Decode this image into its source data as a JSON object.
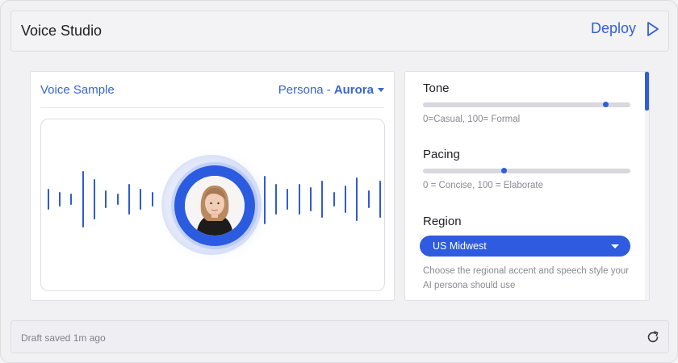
{
  "header": {
    "title": "Voice Studio",
    "deploy_label": "Deploy"
  },
  "voice_card": {
    "title": "Voice Sample",
    "persona_prefix": "Persona -",
    "persona_name": "Aurora"
  },
  "settings": {
    "tone": {
      "label": "Tone",
      "value": 88,
      "hint": "0=Casual, 100= Formal"
    },
    "pacing": {
      "label": "Pacing",
      "value": 39,
      "hint": "0 = Concise, 100 = Elaborate"
    },
    "region": {
      "label": "Region",
      "selected": "US Midwest",
      "description": "Choose the regional accent and speech style your AI persona should use"
    }
  },
  "footer": {
    "status": "Draft saved 1m ago"
  },
  "colors": {
    "accent": "#2f5fd6",
    "bar": "#2f5bd6"
  },
  "icons": [
    "play-icon",
    "caret-down-icon",
    "refresh-icon"
  ]
}
